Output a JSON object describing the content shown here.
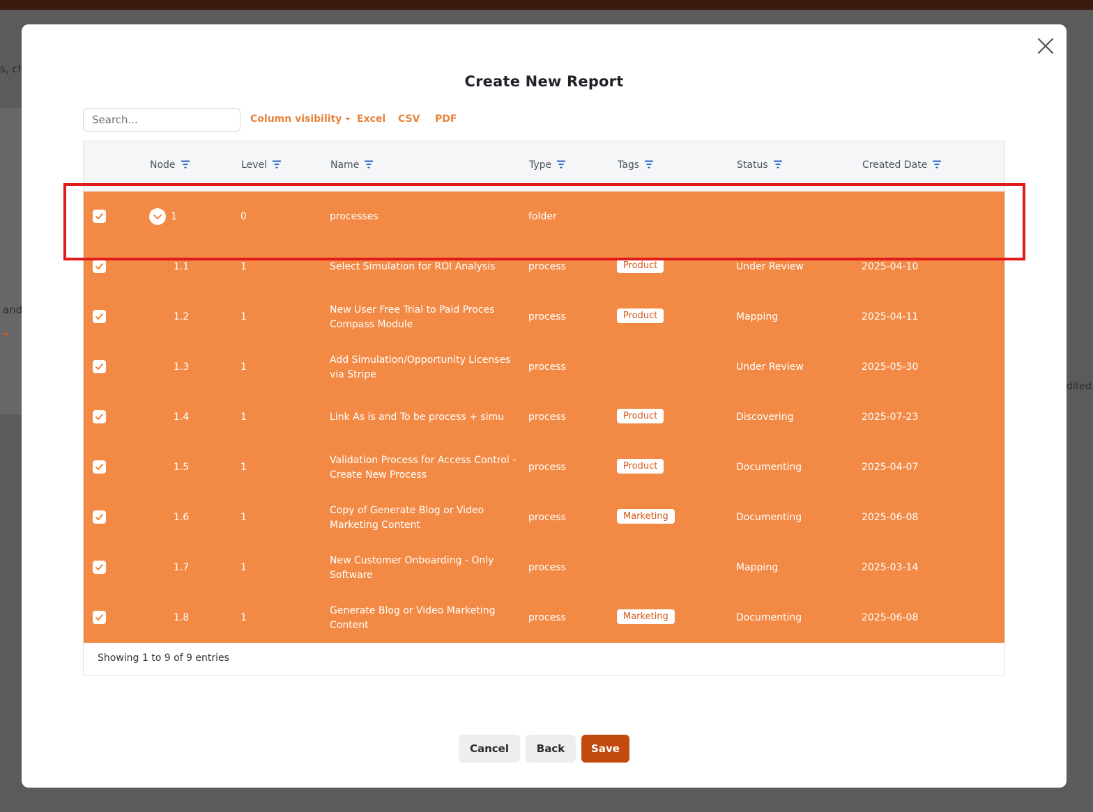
{
  "background": {
    "snippet_1": "s, ch",
    "snippet_2": "and",
    "snippet_3": "dited"
  },
  "modal": {
    "title": "Create New Report",
    "close_icon": "close-icon"
  },
  "toolbar": {
    "search_placeholder": "Search...",
    "column_visibility": "Column visibility",
    "excel": "Excel",
    "csv": "CSV",
    "pdf": "PDF"
  },
  "table": {
    "headers": [
      "Node",
      "Level",
      "Name",
      "Type",
      "Tags",
      "Status",
      "Created Date"
    ],
    "rows": [
      {
        "node": "1",
        "level": "0",
        "name": "processes",
        "type": "folder",
        "tag": "",
        "status": "",
        "created": ""
      },
      {
        "node": "1.1",
        "level": "1",
        "name": "Select Simulation for ROI Analysis",
        "type": "process",
        "tag": "Product",
        "status": "Under Review",
        "created": "2025-04-10"
      },
      {
        "node": "1.2",
        "level": "1",
        "name": "New User Free Trial to Paid Proces Compass Module",
        "type": "process",
        "tag": "Product",
        "status": "Mapping",
        "created": "2025-04-11"
      },
      {
        "node": "1.3",
        "level": "1",
        "name": "Add Simulation/Opportunity Licenses via Stripe",
        "type": "process",
        "tag": "",
        "status": "Under Review",
        "created": "2025-05-30"
      },
      {
        "node": "1.4",
        "level": "1",
        "name": "Link As is and To be process + simu",
        "type": "process",
        "tag": "Product",
        "status": "Discovering",
        "created": "2025-07-23"
      },
      {
        "node": "1.5",
        "level": "1",
        "name": "Validation Process for Access Control - Create New Process",
        "type": "process",
        "tag": "Product",
        "status": "Documenting",
        "created": "2025-04-07"
      },
      {
        "node": "1.6",
        "level": "1",
        "name": "Copy of Generate Blog or Video Marketing Content",
        "type": "process",
        "tag": "Marketing",
        "status": "Documenting",
        "created": "2025-06-08"
      },
      {
        "node": "1.7",
        "level": "1",
        "name": "New Customer Onboarding - Only Software",
        "type": "process",
        "tag": "",
        "status": "Mapping",
        "created": "2025-03-14"
      },
      {
        "node": "1.8",
        "level": "1",
        "name": "Generate Blog or Video Marketing Content",
        "type": "process",
        "tag": "Marketing",
        "status": "Documenting",
        "created": "2025-06-08"
      }
    ],
    "footer": "Showing 1 to 9 of 9 entries"
  },
  "actions": {
    "cancel": "Cancel",
    "back": "Back",
    "save": "Save"
  },
  "colors": {
    "row_bg": "#f28a45",
    "accent": "#e8833c",
    "save_bg": "#c24a0f",
    "highlight": "#e11a1a"
  }
}
